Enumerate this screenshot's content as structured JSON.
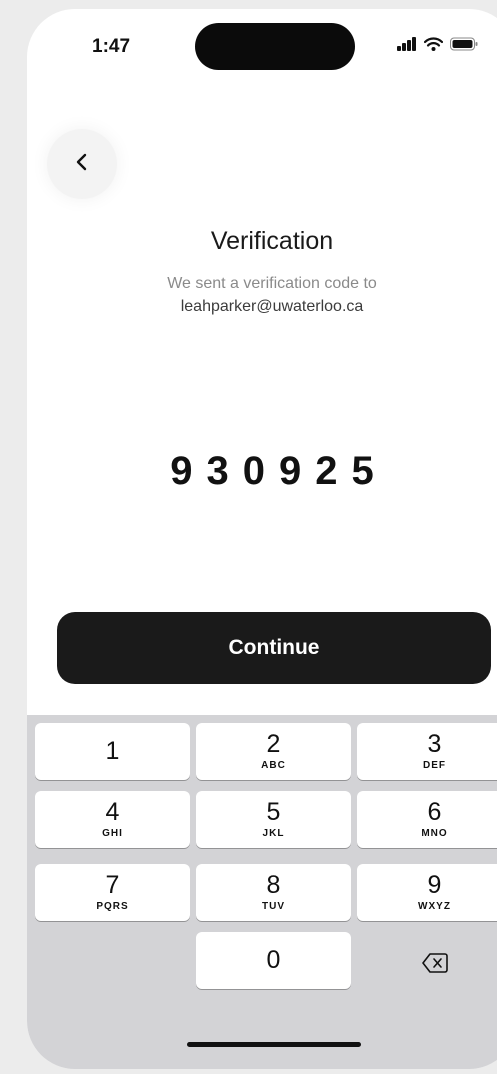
{
  "status_bar": {
    "time": "1:47"
  },
  "header": {
    "title": "Verification",
    "subtitle": "We sent a verification code to",
    "email": "leahparker@uwaterloo.ca"
  },
  "code": {
    "digits": [
      "9",
      "3",
      "0",
      "9",
      "2",
      "5"
    ]
  },
  "actions": {
    "continue_label": "Continue"
  },
  "keyboard": {
    "keys": [
      {
        "num": "1",
        "letters": ""
      },
      {
        "num": "2",
        "letters": "ABC"
      },
      {
        "num": "3",
        "letters": "DEF"
      },
      {
        "num": "4",
        "letters": "GHI"
      },
      {
        "num": "5",
        "letters": "JKL"
      },
      {
        "num": "6",
        "letters": "MNO"
      },
      {
        "num": "7",
        "letters": "PQRS"
      },
      {
        "num": "8",
        "letters": "TUV"
      },
      {
        "num": "9",
        "letters": "WXYZ"
      },
      {
        "num": "0",
        "letters": ""
      }
    ]
  },
  "icons": {
    "back": "chevron-left-icon",
    "signal": "cellular-signal-icon",
    "wifi": "wifi-icon",
    "battery": "battery-icon",
    "delete": "backspace-icon"
  },
  "colors": {
    "primary_button": "#1a1a1a",
    "keyboard_bg": "#d3d3d6",
    "background": "#ececec"
  }
}
